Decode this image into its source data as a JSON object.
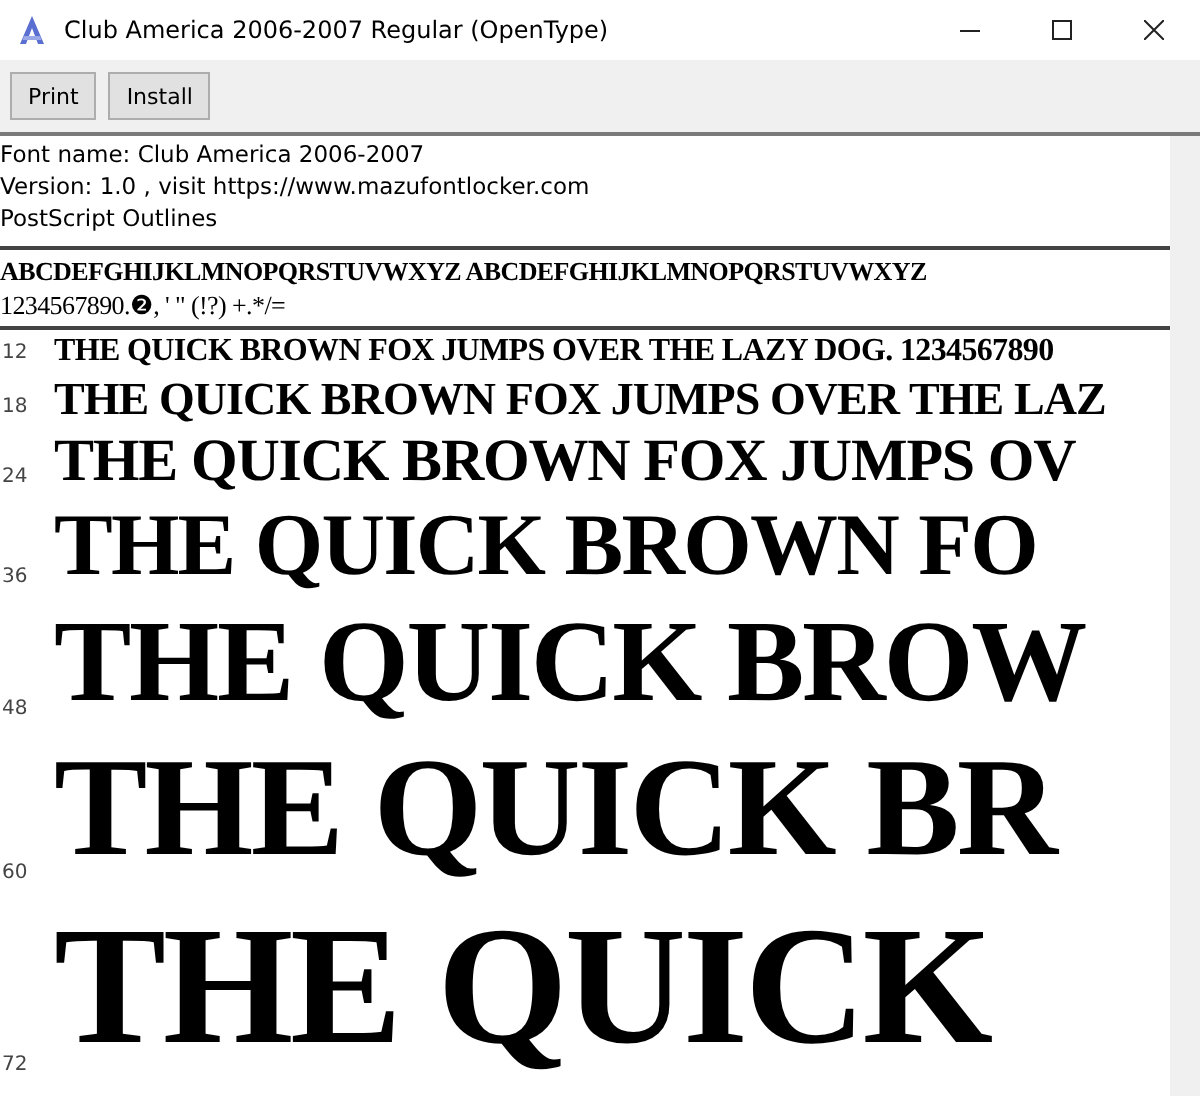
{
  "window": {
    "title": "Club America 2006-2007 Regular (OpenType)"
  },
  "toolbar": {
    "buttons": [
      "Print",
      "Install"
    ]
  },
  "font_info": [
    "Font name: Club America 2006-2007",
    "Version: 1.0 , visit https://www.mazufontlocker.com",
    "PostScript Outlines"
  ],
  "character_set": [
    "ABCDEFGHIJKLMNOPQRSTUVWXYZ ABCDEFGHIJKLMNOPQRSTUVWXYZ",
    "1234567890.❷, ' \" (!?) +.*/="
  ],
  "samples": [
    {
      "size": "12",
      "text": "THE QUICK BROWN FOX JUMPS OVER THE LAZY DOG. 1234567890"
    },
    {
      "size": "18",
      "text": "THE QUICK BROWN FOX JUMPS OVER THE LAZ"
    },
    {
      "size": "24",
      "text": "THE QUICK BROWN FOX JUMPS OV"
    },
    {
      "size": "36",
      "text": "THE QUICK BROWN FO"
    },
    {
      "size": "48",
      "text": "THE QUICK BROW"
    },
    {
      "size": "60",
      "text": "THE QUICK BR"
    },
    {
      "size": "72",
      "text": "THE QUICK"
    }
  ]
}
